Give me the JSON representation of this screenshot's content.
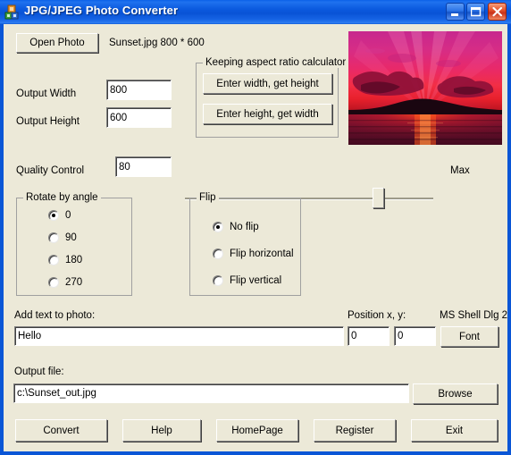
{
  "window": {
    "title": "JPG/JPEG Photo Converter",
    "icon": "app-icon",
    "controls": {
      "minimize": "minimize-icon",
      "maximize": "maximize-icon",
      "close": "close-icon"
    }
  },
  "toolbar": {
    "open_photo_label": "Open Photo",
    "file_info": "Sunset.jpg 800 * 600"
  },
  "size": {
    "width_label": "Output Width",
    "width_value": "800",
    "height_label": "Output Height",
    "height_value": "600"
  },
  "aspect": {
    "group_title": "Keeping aspect ratio calculator",
    "width_to_height_label": "Enter width, get height",
    "height_to_width_label": "Enter height, get width"
  },
  "quality": {
    "label": "Quality Control",
    "value": "80",
    "max_label": "Max"
  },
  "rotate": {
    "group_title": "Rotate by angle",
    "options": [
      {
        "label": "0",
        "selected": true
      },
      {
        "label": "90",
        "selected": false
      },
      {
        "label": "180",
        "selected": false
      },
      {
        "label": "270",
        "selected": false
      }
    ]
  },
  "flip": {
    "group_title": "Flip",
    "options": [
      {
        "label": "No flip",
        "selected": true
      },
      {
        "label": "Flip horizontal",
        "selected": false
      },
      {
        "label": "Flip vertical",
        "selected": false
      }
    ]
  },
  "text_overlay": {
    "label": "Add text to photo:",
    "value": "Hello",
    "position_label": "Position x, y:",
    "position_x": "0",
    "position_y": "0",
    "font_name": "MS Shell Dlg 2",
    "font_button_label": "Font"
  },
  "output": {
    "label": "Output file:",
    "value": "c:\\Sunset_out.jpg",
    "browse_label": "Browse"
  },
  "actions": {
    "convert": "Convert",
    "help": "Help",
    "homepage": "HomePage",
    "register": "Register",
    "exit": "Exit"
  },
  "colors": {
    "titlebar_blue": "#0953D6",
    "client_background": "#ECE9D8",
    "field_background": "#FFFFFF",
    "close_button_red": "#E2512A"
  }
}
